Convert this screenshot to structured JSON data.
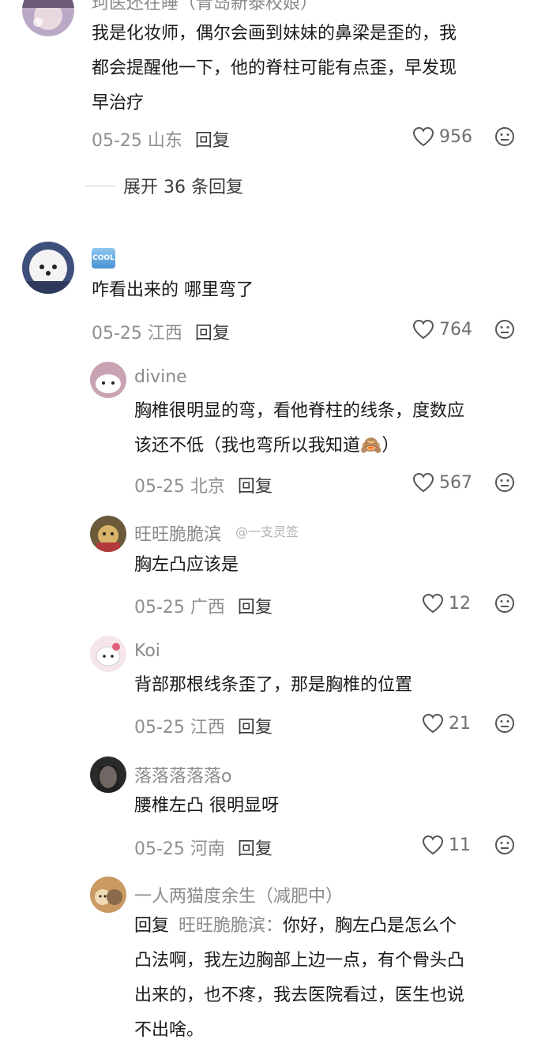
{
  "top_comment": {
    "username": "珂医还在睡（青岛新泰校娘）",
    "text_lines": [
      "我是化妆师，偶尔会画到妹妹的鼻梁是歪的，我",
      "都会提醒他一下，他的脊柱可能有点歪，早发现",
      "早治疗"
    ],
    "meta": "05-25 山东",
    "reply_label": "回复",
    "likes": "956"
  },
  "expand_replies": "展开 36 条回复",
  "comment2": {
    "badge": "COOL",
    "text": "咋看出来的 哪里弯了",
    "meta": "05-25 江西",
    "reply_label": "回复",
    "likes": "764"
  },
  "replies": [
    {
      "username": "divine",
      "text_lines": [
        "胸椎很明显的弯，看他脊柱的线条，度数应",
        "该还不低（我也弯所以我知道🙈）"
      ],
      "meta": "05-25 北京",
      "reply_label": "回复",
      "likes": "567"
    },
    {
      "username": "旺旺脆脆滨",
      "text_lines": [
        "胸左凸应该是"
      ],
      "meta": "05-25 广西",
      "reply_label": "回复",
      "likes": "12"
    },
    {
      "username": "Koi",
      "text_lines": [
        "背部那根线条歪了，那是胸椎的位置"
      ],
      "meta": "05-25 江西",
      "reply_label": "回复",
      "likes": "21"
    },
    {
      "username": "落落落落落o",
      "text_lines": [
        "腰椎左凸 很明显呀"
      ],
      "meta": "05-25 河南",
      "reply_label": "回复",
      "likes": "11"
    },
    {
      "username": "一人两猫度余生（减肥中）",
      "reply_prefix": "回复",
      "mention": "旺旺脆脆滨：",
      "text_lines": [
        "你好，胸左凸是怎么个",
        "凸法啊，我左边胸部上边一点，有个骨头凸",
        "出来的，也不疼，我去医院看过，医生也说",
        "不出啥。"
      ]
    }
  ],
  "watermark": "@一支灵签",
  "colors": {
    "text": "#1a1a1a",
    "meta": "#8f8f8f",
    "username": "#8a8a8a",
    "background": "#ffffff"
  }
}
